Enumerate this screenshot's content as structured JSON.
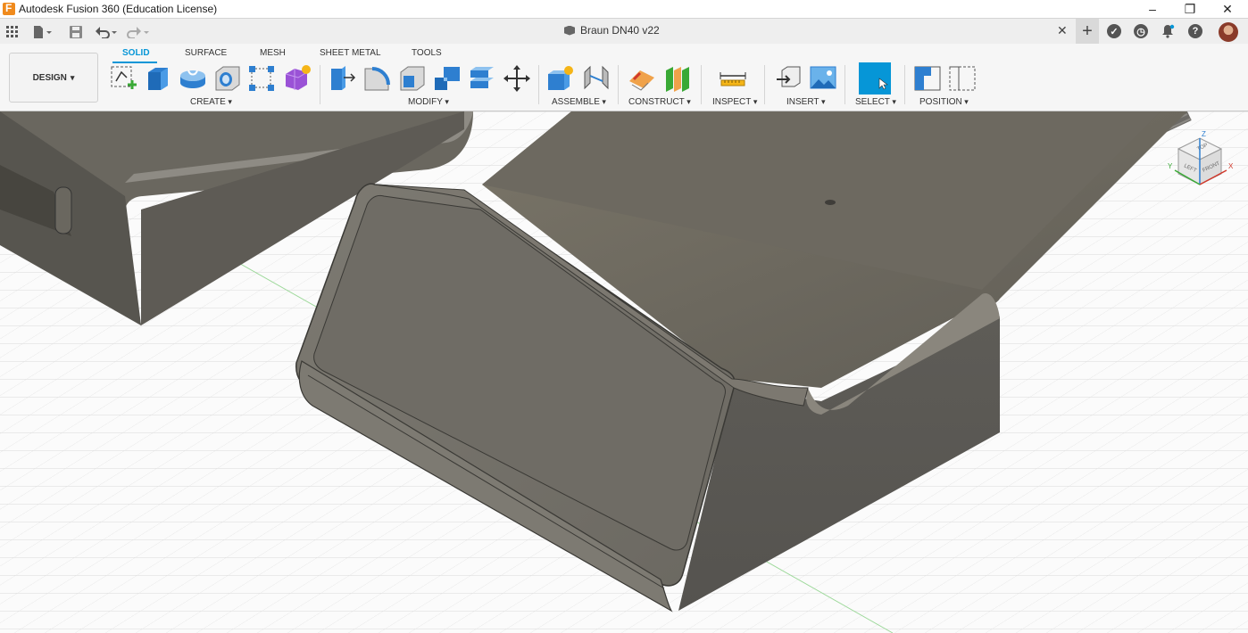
{
  "app": {
    "title": "Autodesk Fusion 360 (Education License)",
    "window_controls": [
      "minimize",
      "restore",
      "close"
    ]
  },
  "document": {
    "name": "Braun DN40 v22",
    "close_symbol": "✕",
    "new_tab_symbol": "+"
  },
  "workspace": {
    "label": "DESIGN",
    "tabs": [
      "SOLID",
      "SURFACE",
      "MESH",
      "SHEET METAL",
      "TOOLS"
    ],
    "active_tab": "SOLID"
  },
  "toolbar_groups": {
    "create": "CREATE",
    "modify": "MODIFY",
    "assemble": "ASSEMBLE",
    "construct": "CONSTRUCT",
    "inspect": "INSPECT",
    "insert": "INSERT",
    "select": "SELECT",
    "position": "POSITION"
  },
  "viewcube": {
    "faces": [
      "TOP",
      "LEFT",
      "FRONT"
    ],
    "axes": [
      "X",
      "Y",
      "Z"
    ]
  },
  "colors": {
    "accent": "#0696d7",
    "model": "#6f6c64",
    "grid": "#dcdcdc"
  }
}
